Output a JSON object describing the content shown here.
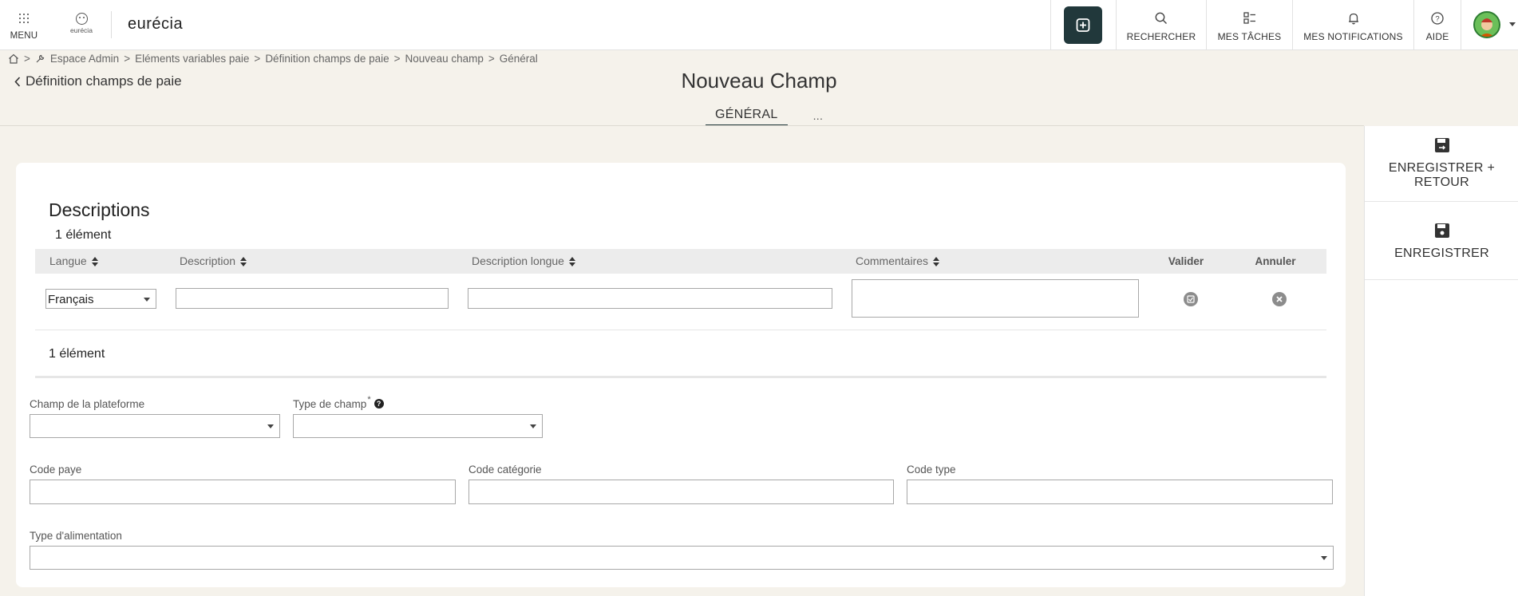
{
  "topbar": {
    "menu_label": "MENU",
    "logo_small_text": "eurécia",
    "brand": "eurécia",
    "nav": [
      {
        "label": "RECHERCHER",
        "icon": "search-icon"
      },
      {
        "label": "MES TÂCHES",
        "icon": "tasks-icon"
      },
      {
        "label": "MES NOTIFICATIONS",
        "icon": "bell-icon"
      },
      {
        "label": "AIDE",
        "icon": "help-icon"
      }
    ],
    "accent": "#21383b"
  },
  "breadcrumb": {
    "separator": ">",
    "items": [
      "Espace Admin",
      "Eléments variables paie",
      "Définition champs de paie",
      "Nouveau champ",
      "Général"
    ]
  },
  "back_link": "Définition champs de paie",
  "page_title": "Nouveau Champ",
  "tabs": [
    {
      "label": "GÉNÉRAL",
      "active": true
    },
    {
      "label": "...",
      "active": false
    }
  ],
  "actions": {
    "save_return": "ENREGISTRER + RETOUR",
    "save": "ENREGISTRER"
  },
  "descriptions": {
    "title": "Descriptions",
    "count_top": "1 élément",
    "count_bottom": "1 élément",
    "columns": [
      "Langue",
      "Description",
      "Description longue",
      "Commentaires",
      "Valider",
      "Annuler"
    ],
    "row": {
      "langue": "Français",
      "description": "",
      "description_longue": "",
      "commentaires": ""
    }
  },
  "form": {
    "champ_plateforme": {
      "label": "Champ de la plateforme",
      "value": ""
    },
    "type_champ": {
      "label": "Type de champ",
      "required_mark": "*",
      "help": "?",
      "value": ""
    },
    "code_paye": {
      "label": "Code paye",
      "value": ""
    },
    "code_categorie": {
      "label": "Code catégorie",
      "value": ""
    },
    "code_type": {
      "label": "Code type",
      "value": ""
    },
    "type_alimentation": {
      "label": "Type d'alimentation",
      "value": ""
    }
  }
}
